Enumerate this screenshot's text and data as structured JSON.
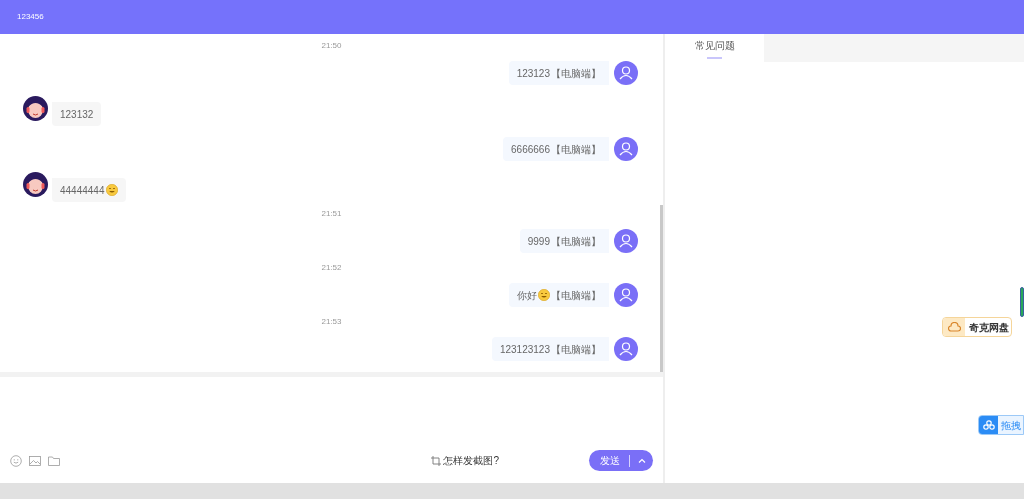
{
  "header": {
    "title": "123456"
  },
  "messages": [
    {
      "kind": "timestamp",
      "text": "21:50"
    },
    {
      "kind": "outgoing",
      "text": "123123",
      "emoji": false,
      "suffix": "【电脑端】"
    },
    {
      "kind": "incoming",
      "text": "123132",
      "emoji": false
    },
    {
      "kind": "outgoing",
      "text": "6666666",
      "emoji": false,
      "suffix": "【电脑端】"
    },
    {
      "kind": "incoming",
      "text": "44444444",
      "emoji": true
    },
    {
      "kind": "timestamp",
      "text": "21:51"
    },
    {
      "kind": "outgoing",
      "text": "9999",
      "emoji": false,
      "suffix": "【电脑端】"
    },
    {
      "kind": "timestamp",
      "text": "21:52"
    },
    {
      "kind": "outgoing",
      "text": "你好",
      "emoji": true,
      "suffix": "【电脑端】"
    },
    {
      "kind": "timestamp",
      "text": "21:53"
    },
    {
      "kind": "outgoing",
      "text": "123123123",
      "emoji": false,
      "suffix": "【电脑端】"
    }
  ],
  "composer": {
    "screenshot_help": "怎样发截图?",
    "send_button": "发送"
  },
  "side_panel": {
    "tabs": [
      {
        "label": "常见问题",
        "selected": true
      }
    ]
  },
  "floating_widgets": [
    {
      "kind": "cloud",
      "label": "奇克网盘"
    },
    {
      "kind": "share",
      "label": "拖拽"
    }
  ]
}
